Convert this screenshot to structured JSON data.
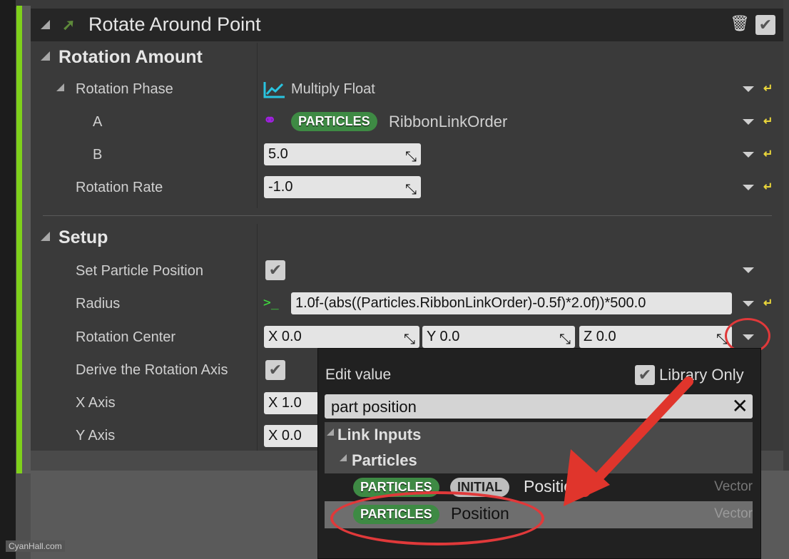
{
  "module": {
    "title": "Rotate Around Point",
    "accent": "#7fd11b"
  },
  "sections": [
    {
      "title": "Rotation Amount",
      "rows": [
        {
          "label": "Rotation Phase",
          "value": "Multiply Float"
        },
        {
          "label": "A",
          "badge": "PARTICLES",
          "value": "RibbonLinkOrder"
        },
        {
          "label": "B",
          "value": "5.0"
        },
        {
          "label": "Rotation Rate",
          "value": "-1.0"
        }
      ]
    },
    {
      "title": "Setup",
      "rows": [
        {
          "label": "Set Particle Position",
          "checked": true
        },
        {
          "label": "Radius",
          "prompt": ">_",
          "value": "1.0f-(abs((Particles.RibbonLinkOrder)-0.5f)*2.0f))*500.0"
        },
        {
          "label": "Rotation Center",
          "x": "X 0.0",
          "y": "Y 0.0",
          "z": "Z 0.0"
        },
        {
          "label": "Derive the Rotation Axis",
          "checked": true
        },
        {
          "label": "X Axis",
          "value": "X 1.0"
        },
        {
          "label": "Y Axis",
          "value": "X 0.0"
        }
      ]
    }
  ],
  "popup": {
    "title": "Edit value",
    "library_only": "Library Only",
    "library_only_checked": true,
    "search": "part position",
    "category": "Link Inputs",
    "subcategory": "Particles",
    "items": [
      {
        "badges": [
          "PARTICLES",
          "INITIAL"
        ],
        "name": "Position",
        "type": "Vector"
      },
      {
        "badges": [
          "PARTICLES"
        ],
        "name": "Position",
        "type": "Vector",
        "selected": true
      }
    ]
  },
  "watermark": "CyanHall.com",
  "colors": {
    "highlight": "#e0393a",
    "particles_badge": "#3e8a44"
  }
}
